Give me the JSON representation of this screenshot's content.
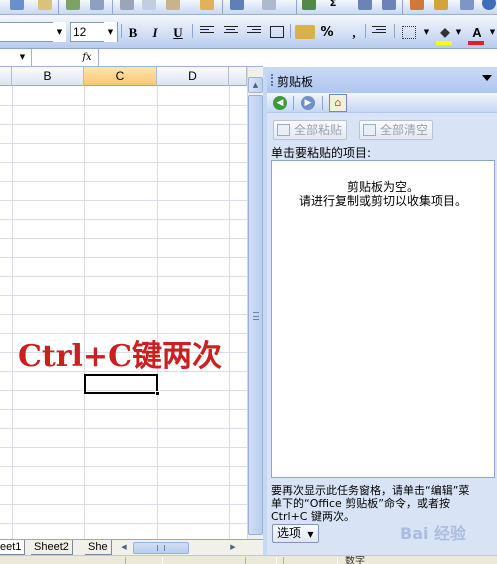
{
  "toolbar": {
    "font_size": "12",
    "bold_label": "B",
    "italic_label": "I",
    "underline_label": "U",
    "percent_label": "%",
    "comma_label": ",",
    "sigma_label": "Σ",
    "text_color_label": "A"
  },
  "formula_bar": {
    "fx_label": "fx"
  },
  "grid": {
    "columns": [
      "B",
      "C",
      "D"
    ],
    "selected_column": "C",
    "annotation": "Ctrl+C键两次"
  },
  "sheet_tabs": [
    "eet1",
    "Sheet2",
    "She"
  ],
  "task_pane": {
    "title": "剪贴板",
    "paste_all": "全部粘贴",
    "clear_all": "全部清空",
    "instruction": "单击要粘贴的项目:",
    "empty_line1": "剪贴板为空。",
    "empty_line2": "请进行复制或剪切以收集项目。",
    "note": "要再次显示此任务窗格，请单击“编辑”菜\n单下的“Office 剪贴板”命令，或者按\nCtrl+C 键两次。",
    "options": "选项"
  },
  "status": {
    "num": "数字"
  },
  "watermark": "Bai 经验"
}
